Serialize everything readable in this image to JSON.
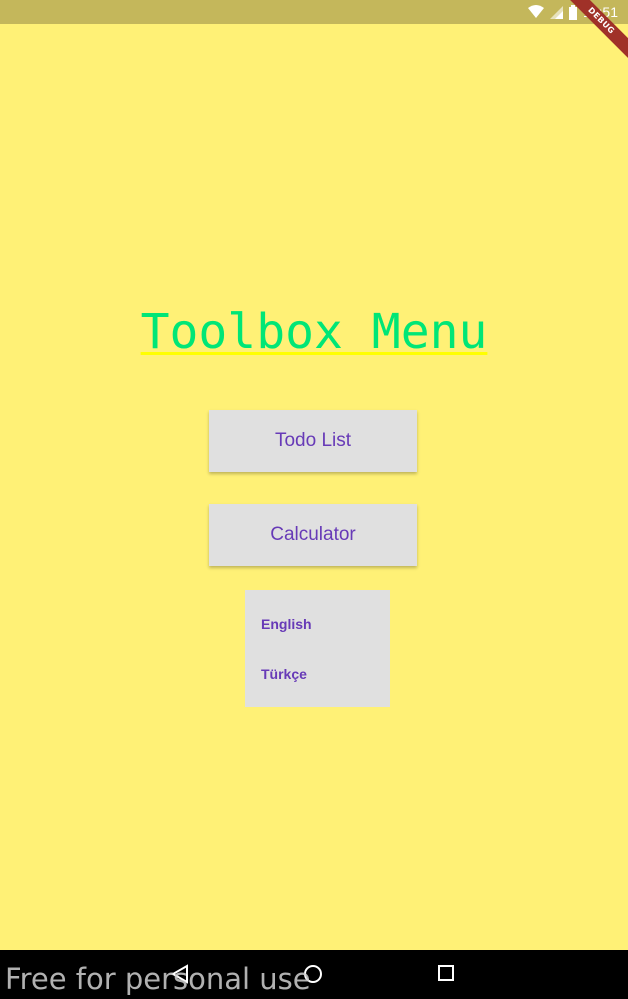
{
  "status_bar": {
    "time": "12:51",
    "icons": [
      "wifi-icon",
      "cell-signal-icon",
      "battery-icon"
    ],
    "background": "#C4B75B"
  },
  "debug_banner": "DEBUG",
  "screen": {
    "background": "#FFF176",
    "title": "Toolbox Menu",
    "title_color": "#00E676",
    "buttons": {
      "todo_label": "Todo List",
      "calculator_label": "Calculator"
    },
    "button_text_color": "#673AB7",
    "language_menu": {
      "items": [
        "English",
        "Türkçe"
      ]
    }
  },
  "nav_bar": {
    "icons": [
      "back-icon",
      "home-icon",
      "recent-apps-icon"
    ]
  },
  "watermark": "Free for personal use"
}
